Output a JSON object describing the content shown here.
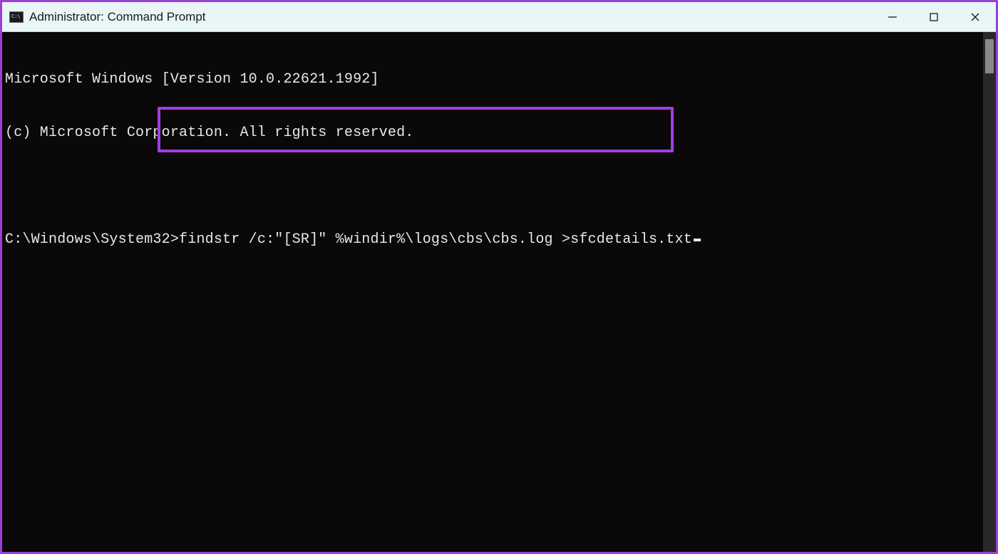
{
  "window": {
    "title": "Administrator: Command Prompt"
  },
  "console": {
    "line1": "Microsoft Windows [Version 10.0.22621.1992]",
    "line2": "(c) Microsoft Corporation. All rights reserved.",
    "prompt": "C:\\Windows\\System32>",
    "command": "findstr /c:\"[SR]\" %windir%\\logs\\cbs\\cbs.log >sfcdetails.txt"
  }
}
